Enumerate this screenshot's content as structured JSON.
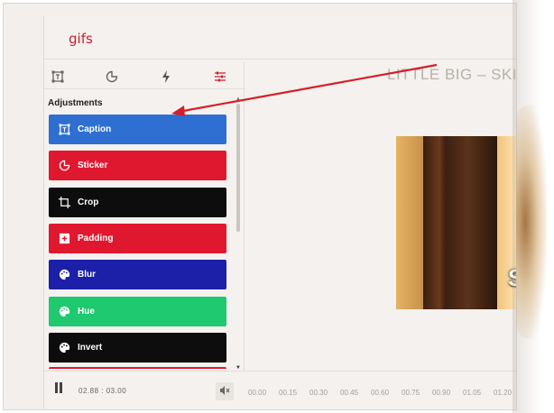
{
  "app": {
    "logo": "gifs"
  },
  "sidebar": {
    "tabs": [
      {
        "icon": "text-frame-icon"
      },
      {
        "icon": "sticker-icon"
      },
      {
        "icon": "lightning-icon"
      },
      {
        "icon": "sliders-icon"
      }
    ],
    "section_title": "Adjustments",
    "items": [
      {
        "label": "Caption",
        "color": "#2f6fd1",
        "icon": "text-frame-icon"
      },
      {
        "label": "Sticker",
        "color": "#e0182f",
        "icon": "sticker-icon"
      },
      {
        "label": "Crop",
        "color": "#0d0d0d",
        "icon": "crop-icon"
      },
      {
        "label": "Padding",
        "color": "#e0182f",
        "icon": "padding-icon"
      },
      {
        "label": "Blur",
        "color": "#1c1fa8",
        "icon": "palette-icon"
      },
      {
        "label": "Hue",
        "color": "#1ec96f",
        "icon": "palette-icon"
      },
      {
        "label": "Invert",
        "color": "#0d0d0d",
        "icon": "palette-icon"
      }
    ]
  },
  "main": {
    "video_title": "LITTLE BIG – SKIE",
    "preview_caption": "S"
  },
  "playback": {
    "time": "02.88 : 03.00",
    "ticks": [
      "00.00",
      "00.15",
      "00.30",
      "00.45",
      "00.60",
      "00.75",
      "00.90",
      "01.05",
      "01.20"
    ]
  },
  "colors": {
    "accent_red": "#d11d2d",
    "annotation_arrow": "#d41f2a"
  }
}
